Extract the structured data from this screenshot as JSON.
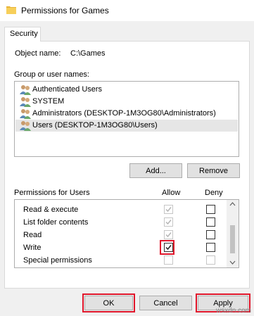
{
  "window": {
    "title": "Permissions for Games"
  },
  "tabs": [
    {
      "label": "Security"
    }
  ],
  "object": {
    "label": "Object name:",
    "value": "C:\\Games"
  },
  "groups": {
    "label": "Group or user names:",
    "items": [
      {
        "label": "Authenticated Users"
      },
      {
        "label": "SYSTEM"
      },
      {
        "label": "Administrators (DESKTOP-1M3OG80\\Administrators)"
      },
      {
        "label": "Users (DESKTOP-1M3OG80\\Users)"
      }
    ],
    "selected_index": 3,
    "add_label": "Add...",
    "remove_label": "Remove"
  },
  "permissions": {
    "label": "Permissions for Users",
    "allow_header": "Allow",
    "deny_header": "Deny",
    "rows": [
      {
        "label": "Read & execute",
        "allow": true,
        "allow_disabled": true,
        "deny": false,
        "deny_disabled": false
      },
      {
        "label": "List folder contents",
        "allow": true,
        "allow_disabled": true,
        "deny": false,
        "deny_disabled": false
      },
      {
        "label": "Read",
        "allow": true,
        "allow_disabled": true,
        "deny": false,
        "deny_disabled": false
      },
      {
        "label": "Write",
        "allow": true,
        "allow_disabled": false,
        "deny": false,
        "deny_disabled": false
      },
      {
        "label": "Special permissions",
        "allow": false,
        "allow_disabled": true,
        "deny": false,
        "deny_disabled": true
      }
    ]
  },
  "footer": {
    "ok_label": "OK",
    "cancel_label": "Cancel",
    "apply_label": "Apply"
  },
  "watermark": "wsxdn.com",
  "colors": {
    "highlight": "#e0162b",
    "selected_row": "#e6e6e6",
    "button_face": "#e1e1e1"
  }
}
